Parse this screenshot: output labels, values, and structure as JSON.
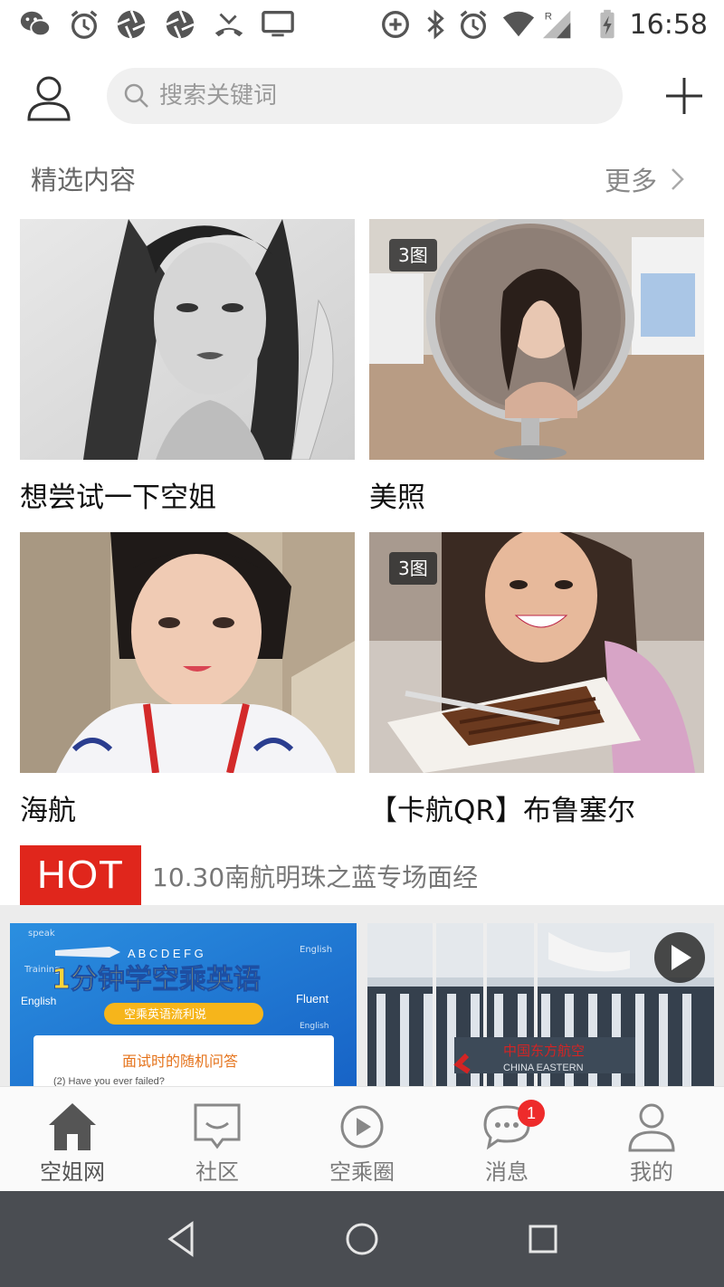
{
  "status_bar": {
    "time": "16:58",
    "left_icons": [
      "wechat-icon",
      "alarm-icon",
      "aperture-icon",
      "aperture-icon",
      "missed-call-icon",
      "screen-cast-icon"
    ],
    "right_icons": [
      "data-saver-icon",
      "bluetooth-icon",
      "alarm-icon",
      "wifi-icon",
      "signal-roaming-icon",
      "battery-charging-icon"
    ]
  },
  "header": {
    "profile_icon": "person-icon",
    "search": {
      "placeholder": "搜索关键词",
      "value": "",
      "icon": "search-icon"
    },
    "add_icon": "plus-icon"
  },
  "featured": {
    "title": "精选内容",
    "more_label": "更多",
    "more_icon": "chevron-right-icon",
    "items": [
      {
        "title": "想尝试一下空姐",
        "badge": ""
      },
      {
        "title": "美照",
        "badge": "3图"
      },
      {
        "title": "海航",
        "badge": ""
      },
      {
        "title": "【卡航QR】布鲁塞尔",
        "badge": "3图"
      }
    ]
  },
  "hot": {
    "badge": "HOT",
    "text": "10.30南航明珠之蓝专场面经"
  },
  "videos": {
    "left": {
      "labels": {
        "speak": "speak",
        "letters": "A B C D E F G",
        "english_top": "English",
        "training": "Training",
        "headline": "1分钟学空乘英语",
        "english_left": "English",
        "fluent": "Fluent",
        "english_bottom": "English",
        "tagline": "空乘英语流利说",
        "card_title": "面试时的随机问答",
        "question": "(2) Have you ever failed?"
      }
    },
    "right": {
      "sign_text": "中国东方航空",
      "sign_en": "CHINA EASTERN",
      "play_icon": "play-icon"
    }
  },
  "bottom_nav": {
    "items": [
      {
        "label": "空姐网",
        "icon": "home-icon",
        "active": true
      },
      {
        "label": "社区",
        "icon": "chat-box-icon",
        "active": false
      },
      {
        "label": "空乘圈",
        "icon": "play-circle-icon",
        "active": false
      },
      {
        "label": "消息",
        "icon": "message-bubble-icon",
        "active": false,
        "badge": "1"
      },
      {
        "label": "我的",
        "icon": "person-icon",
        "active": false
      }
    ]
  },
  "system_nav": {
    "icons": [
      "back-triangle-icon",
      "home-circle-icon",
      "recents-square-icon"
    ]
  }
}
